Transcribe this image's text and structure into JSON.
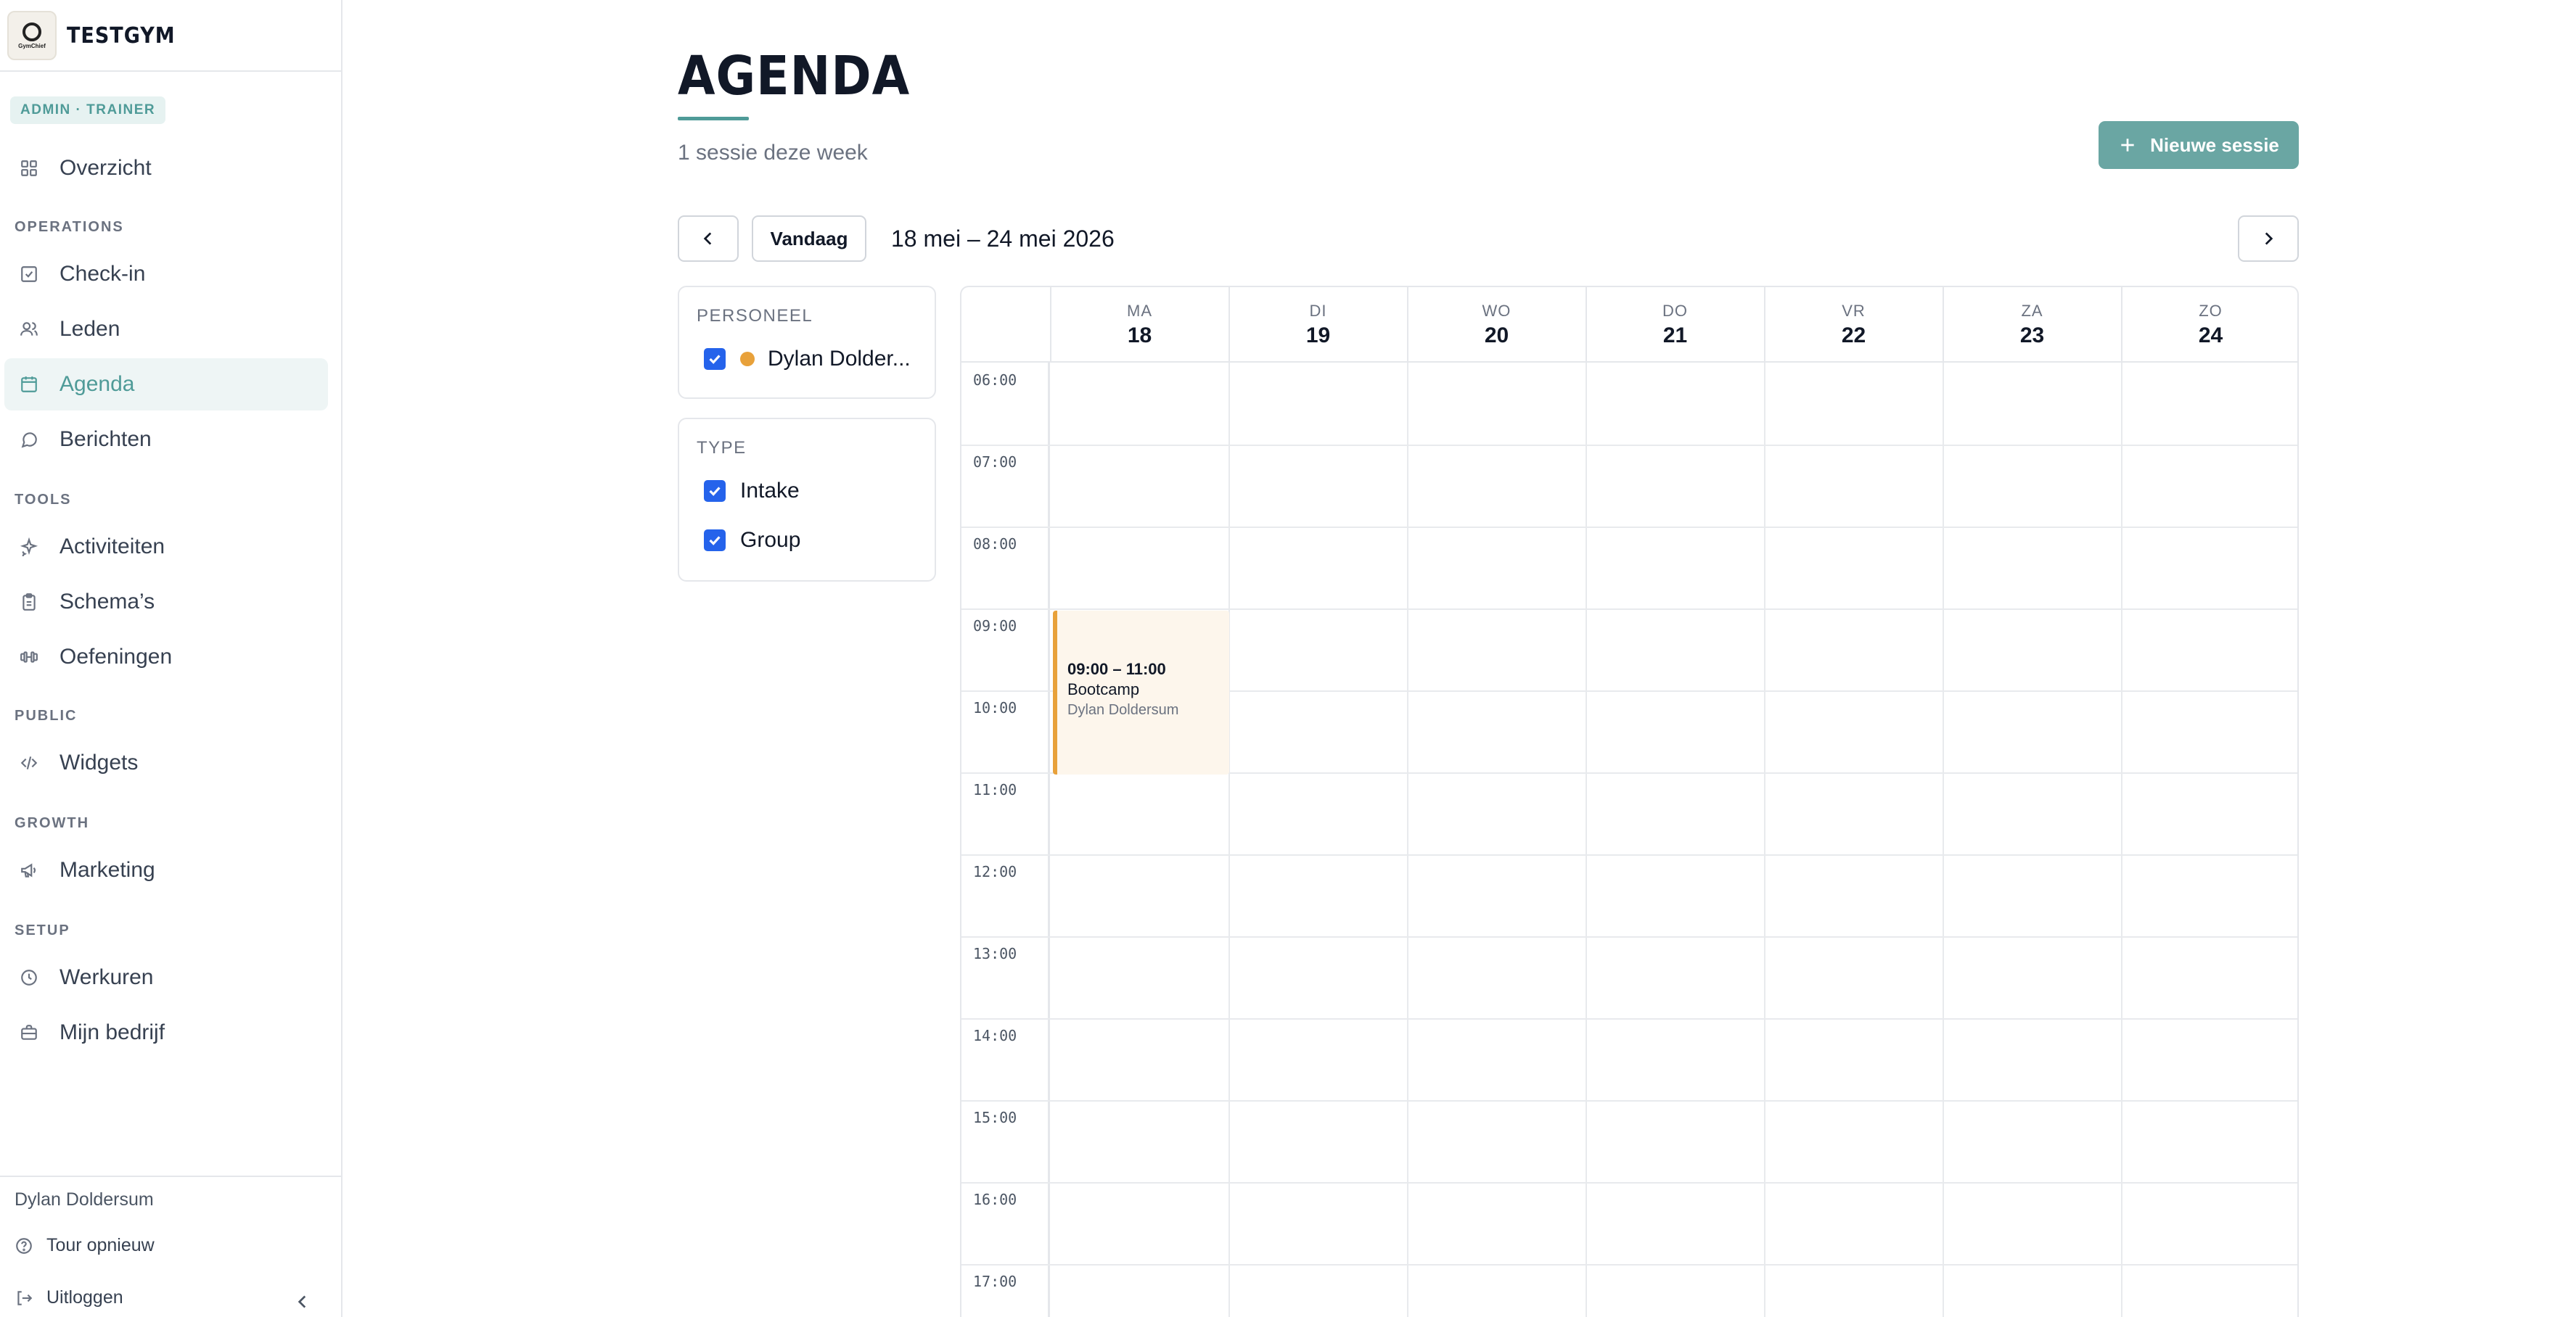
{
  "brand": {
    "name": "TESTGYM",
    "logo_text": "GymChief"
  },
  "role_badge": "ADMIN · TRAINER",
  "nav": {
    "overview": {
      "label": "Overzicht",
      "icon": "grid-icon"
    },
    "sections": [
      {
        "title": "OPERATIONS",
        "items": [
          {
            "label": "Check-in",
            "icon": "check-square-icon"
          },
          {
            "label": "Leden",
            "icon": "users-icon"
          },
          {
            "label": "Agenda",
            "icon": "calendar-icon",
            "active": true
          },
          {
            "label": "Berichten",
            "icon": "message-icon"
          }
        ]
      },
      {
        "title": "TOOLS",
        "items": [
          {
            "label": "Activiteiten",
            "icon": "sparkle-icon"
          },
          {
            "label": "Schema’s",
            "icon": "clipboard-icon"
          },
          {
            "label": "Oefeningen",
            "icon": "dumbbell-icon"
          }
        ]
      },
      {
        "title": "PUBLIC",
        "items": [
          {
            "label": "Widgets",
            "icon": "code-icon"
          }
        ]
      },
      {
        "title": "GROWTH",
        "items": [
          {
            "label": "Marketing",
            "icon": "megaphone-icon"
          }
        ]
      },
      {
        "title": "SETUP",
        "items": [
          {
            "label": "Werkuren",
            "icon": "clock-icon"
          },
          {
            "label": "Mijn bedrijf",
            "icon": "briefcase-icon"
          }
        ]
      }
    ]
  },
  "footer": {
    "user_name": "Dylan Doldersum",
    "tour_label": "Tour opnieuw",
    "logout_label": "Uitloggen"
  },
  "page": {
    "title": "AGENDA",
    "subtitle": "1 sessie deze week",
    "new_session_label": "Nieuwe sessie"
  },
  "toolbar": {
    "today_label": "Vandaag",
    "range_label": "18 mei – 24 mei 2026"
  },
  "filters": {
    "staff": {
      "title": "PERSONEEL",
      "items": [
        {
          "label": "Dylan Dolder...",
          "checked": true,
          "color": "#e8a13a"
        }
      ]
    },
    "type": {
      "title": "TYPE",
      "items": [
        {
          "label": "Intake",
          "checked": true
        },
        {
          "label": "Group",
          "checked": true
        }
      ]
    }
  },
  "calendar": {
    "days": [
      {
        "dow": "MA",
        "num": "18"
      },
      {
        "dow": "DI",
        "num": "19"
      },
      {
        "dow": "WO",
        "num": "20"
      },
      {
        "dow": "DO",
        "num": "21"
      },
      {
        "dow": "VR",
        "num": "22"
      },
      {
        "dow": "ZA",
        "num": "23"
      },
      {
        "dow": "ZO",
        "num": "24"
      }
    ],
    "hours": [
      "06:00",
      "07:00",
      "08:00",
      "09:00",
      "10:00",
      "11:00",
      "12:00",
      "13:00",
      "14:00",
      "15:00",
      "16:00",
      "17:00"
    ],
    "events": [
      {
        "time": "09:00 – 11:00",
        "title": "Bootcamp",
        "staff": "Dylan Doldersum",
        "day": "MA",
        "color": "#e8a13a"
      }
    ]
  },
  "colors": {
    "accent": "#4f9b98",
    "button": "#6aa6a3",
    "checkbox": "#2563eb",
    "event": "#e8a13a"
  }
}
